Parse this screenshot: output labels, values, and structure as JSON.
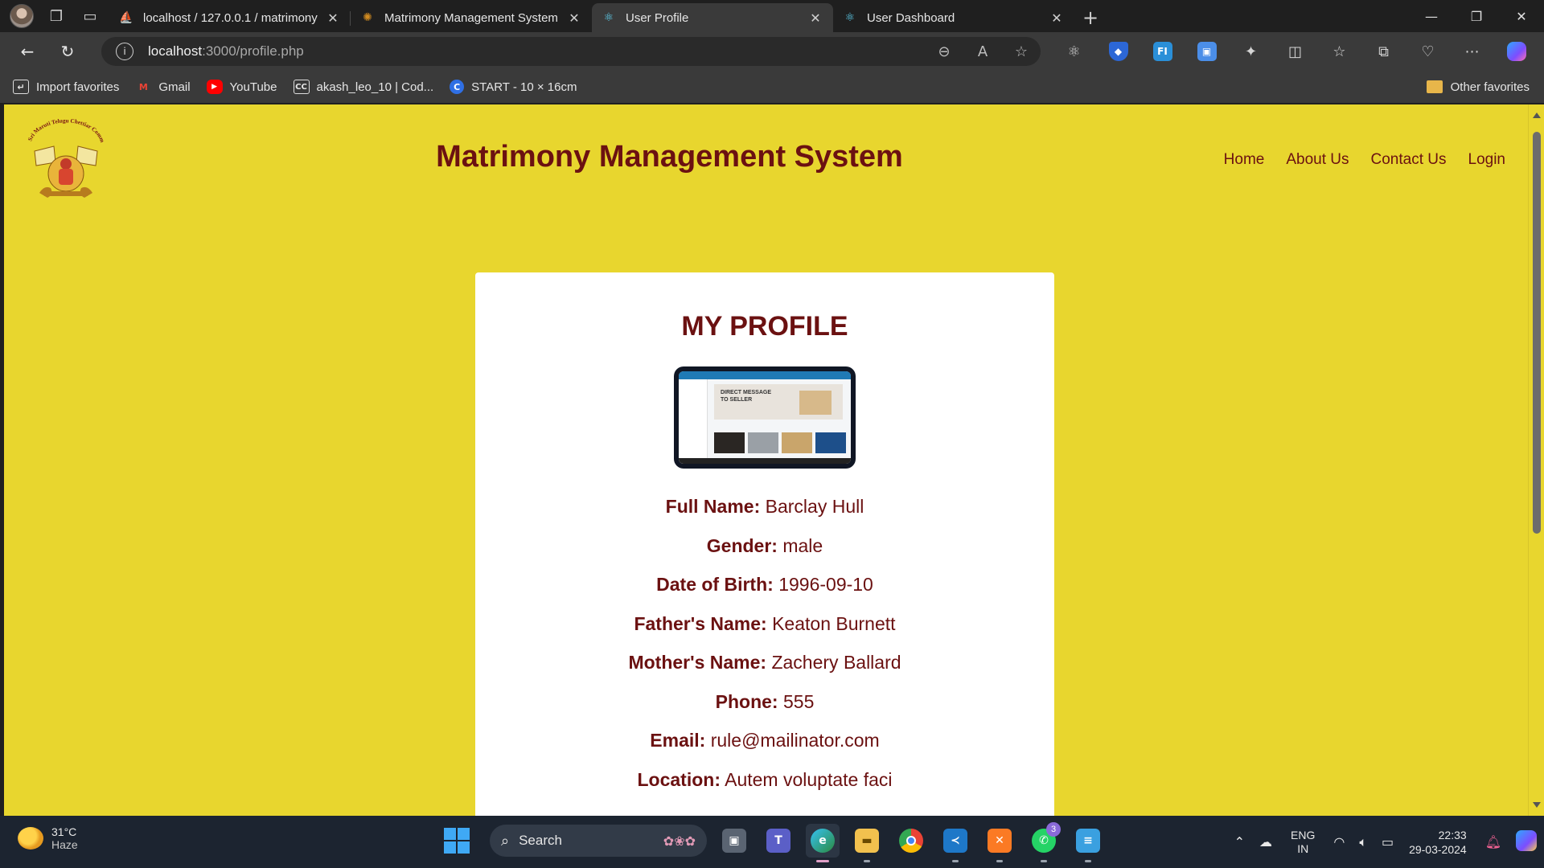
{
  "browser": {
    "tabs": [
      {
        "title": "localhost / 127.0.0.1 / matrimony",
        "favicon": "phpmyadmin-icon",
        "active": false
      },
      {
        "title": "Matrimony Management System",
        "favicon": "site-logo-icon",
        "active": false
      },
      {
        "title": "User Profile",
        "favicon": "react-icon",
        "active": true
      },
      {
        "title": "User Dashboard",
        "favicon": "react-icon",
        "active": false
      }
    ],
    "url_host": "localhost",
    "url_path": ":3000/profile.php",
    "favorites": [
      {
        "label": "Import favorites",
        "icon": "import-icon"
      },
      {
        "label": "Gmail",
        "icon": "gmail-icon"
      },
      {
        "label": "YouTube",
        "icon": "youtube-icon"
      },
      {
        "label": "akash_leo_10 | Cod...",
        "icon": "codechef-icon"
      },
      {
        "label": "START - 10 × 16cm",
        "icon": "canva-icon"
      }
    ],
    "other_favorites": "Other favorites"
  },
  "site": {
    "title": "Matrimony Management System",
    "logo_text": "Sri Maruti Telugu Chettiar Community",
    "nav": [
      "Home",
      "About Us",
      "Contact Us",
      "Login"
    ]
  },
  "profile": {
    "heading": "MY PROFILE",
    "photo_caption": "DIRECT MESSAGE TO SELLER",
    "fields": [
      {
        "label": "Full Name:",
        "value": "Barclay Hull"
      },
      {
        "label": "Gender:",
        "value": "male"
      },
      {
        "label": "Date of Birth:",
        "value": "1996-09-10"
      },
      {
        "label": "Father's Name:",
        "value": "Keaton Burnett"
      },
      {
        "label": "Mother's Name:",
        "value": "Zachery Ballard"
      },
      {
        "label": "Phone:",
        "value": "555"
      },
      {
        "label": "Email:",
        "value": "rule@mailinator.com"
      },
      {
        "label": "Location:",
        "value": "Autem voluptate faci"
      }
    ]
  },
  "taskbar": {
    "temperature": "31°C",
    "weather": "Haze",
    "search_placeholder": "Search",
    "whatsapp_badge": "3",
    "lang_line1": "ENG",
    "lang_line2": "IN",
    "time": "22:33",
    "date": "29-03-2024"
  },
  "colors": {
    "page_background": "#e8d62e",
    "brand_maroon": "#6b1111",
    "card": "#ffffff"
  }
}
